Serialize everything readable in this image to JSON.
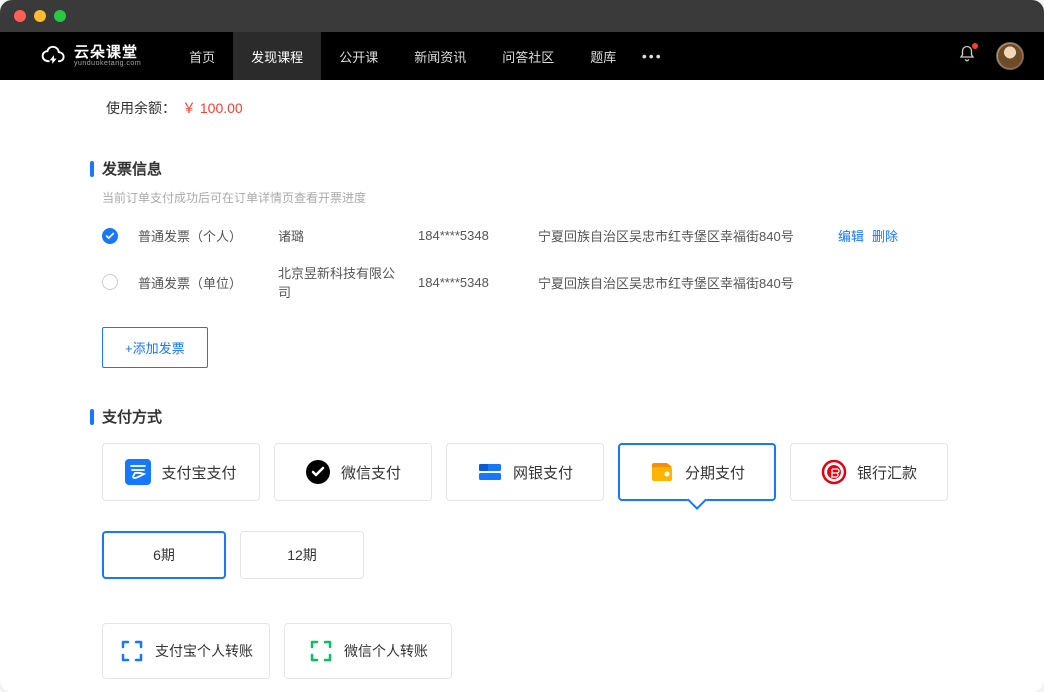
{
  "logo": {
    "name": "云朵课堂",
    "sub": "yunduoketang.com"
  },
  "nav": {
    "items": [
      {
        "label": "首页",
        "active": false
      },
      {
        "label": "发现课程",
        "active": true
      },
      {
        "label": "公开课",
        "active": false
      },
      {
        "label": "新闻资讯",
        "active": false
      },
      {
        "label": "问答社区",
        "active": false
      },
      {
        "label": "题库",
        "active": false
      }
    ]
  },
  "balance": {
    "label": "使用余额：",
    "value": "￥ 100.00"
  },
  "invoice": {
    "title": "发票信息",
    "hint": "当前订单支付成功后可在订单详情页查看开票进度",
    "add_label": "+添加发票",
    "rows": [
      {
        "checked": true,
        "type": "普通发票（个人）",
        "name": "诸璐",
        "phone": "184****5348",
        "addr": "宁夏回族自治区吴忠市红寺堡区幸福街840号",
        "edit": "编辑",
        "del": "删除"
      },
      {
        "checked": false,
        "type": "普通发票（单位）",
        "name": "北京昱新科技有限公司",
        "phone": "184****5348",
        "addr": "宁夏回族自治区吴忠市红寺堡区幸福街840号"
      }
    ]
  },
  "payment": {
    "title": "支付方式",
    "options": [
      {
        "id": "alipay",
        "label": "支付宝支付",
        "selected": false
      },
      {
        "id": "wechat",
        "label": "微信支付",
        "selected": false
      },
      {
        "id": "unionpay",
        "label": "网银支付",
        "selected": false
      },
      {
        "id": "installment",
        "label": "分期支付",
        "selected": true
      },
      {
        "id": "bankwire",
        "label": "银行汇款",
        "selected": false
      }
    ],
    "installments": [
      {
        "label": "6期",
        "selected": true
      },
      {
        "label": "12期",
        "selected": false
      }
    ],
    "transfers": [
      {
        "id": "alipay-transfer",
        "label": "支付宝个人转账"
      },
      {
        "id": "wechat-transfer",
        "label": "微信个人转账"
      }
    ]
  }
}
